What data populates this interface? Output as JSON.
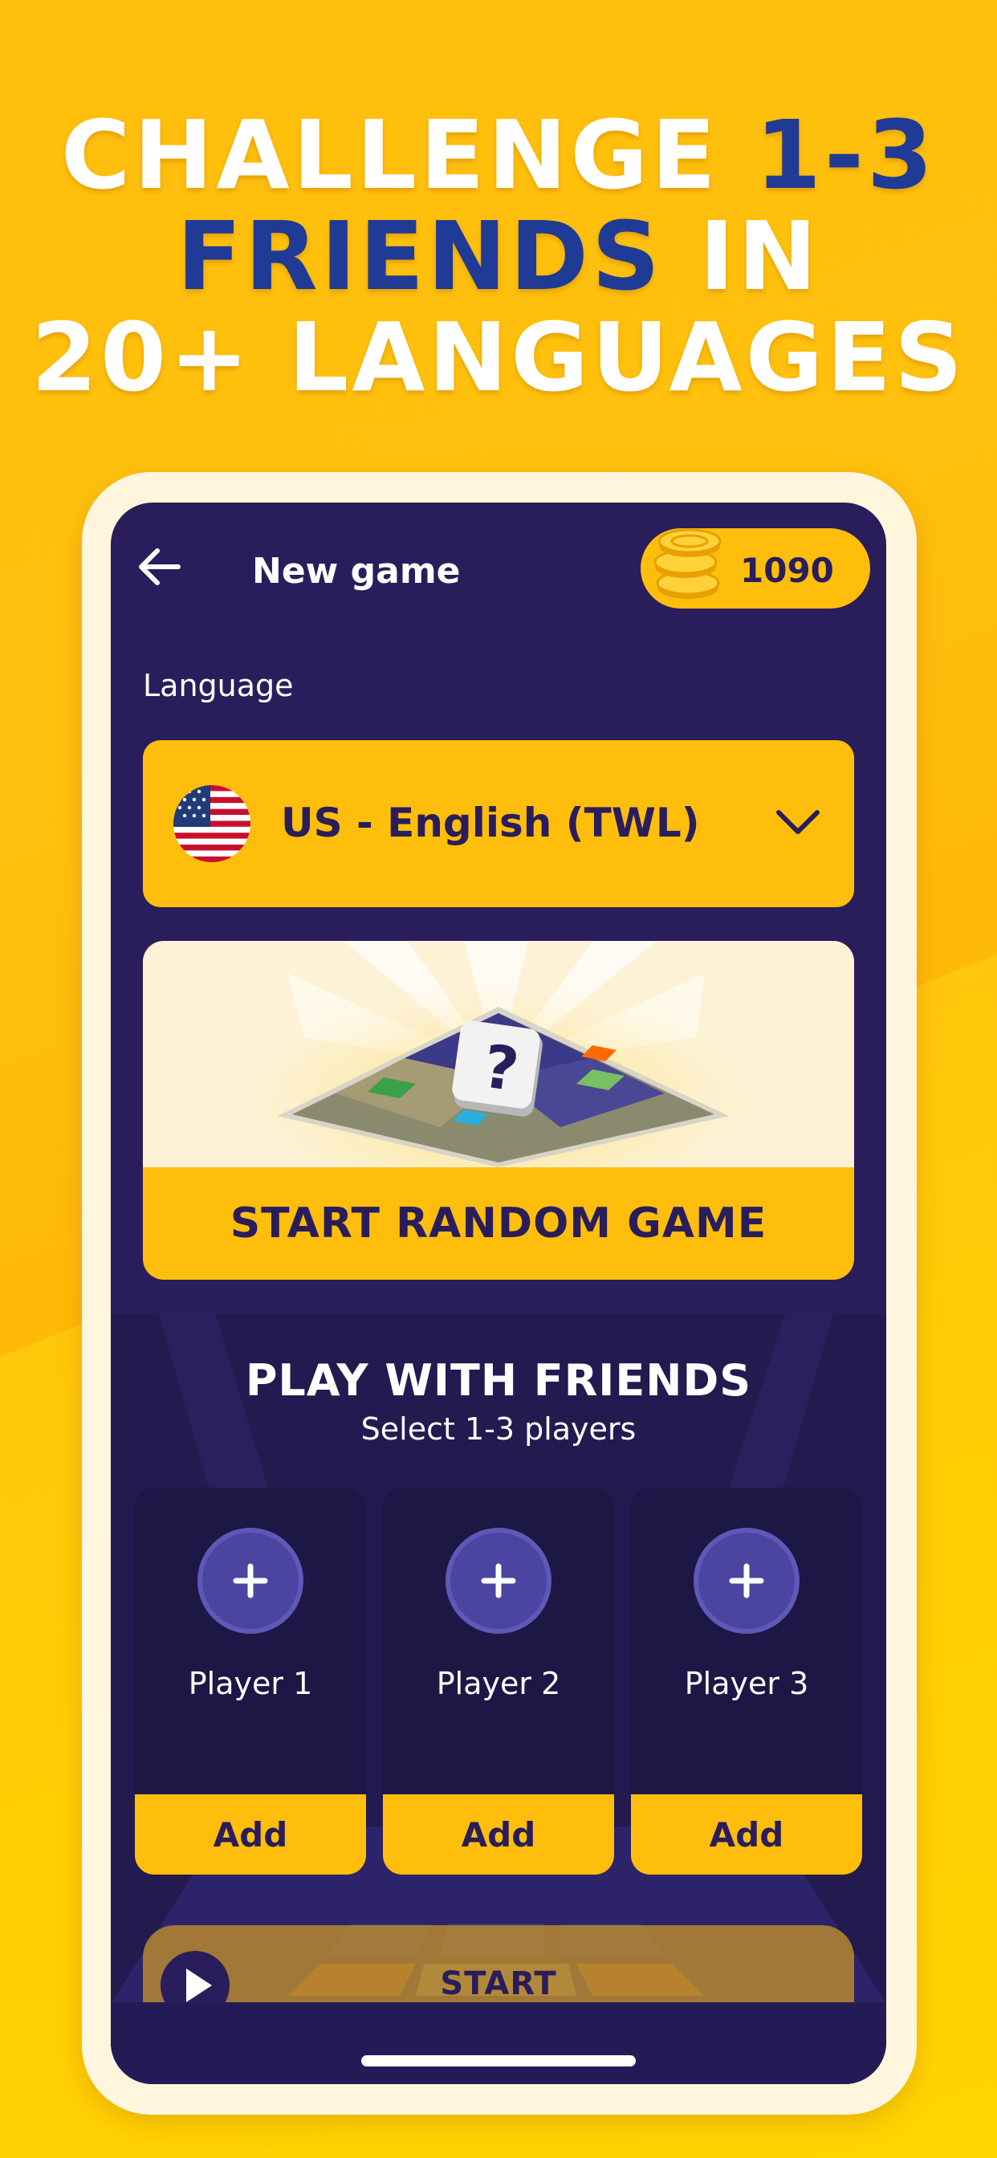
{
  "headline": {
    "line1_white": "CHALLENGE ",
    "line1_blue": "1-3",
    "line2_blue": "FRIENDS",
    "line2_white": " IN",
    "line3_white": "20+ LANGUAGES"
  },
  "header": {
    "title": "New game",
    "coins": "1090"
  },
  "language": {
    "label": "Language",
    "selected": "US - English (TWL)"
  },
  "random_game": {
    "tile_letter": "?",
    "label": "START RANDOM GAME"
  },
  "friends": {
    "title": "PLAY WITH FRIENDS",
    "subtitle": "Select 1-3 players",
    "players": [
      {
        "name": "Player 1",
        "button": "Add",
        "icon": "+"
      },
      {
        "name": "Player 2",
        "button": "Add",
        "icon": "+"
      },
      {
        "name": "Player 3",
        "button": "Add",
        "icon": "+"
      }
    ]
  },
  "start": {
    "label": "START"
  },
  "colors": {
    "accent": "#ffbe0b",
    "navy": "#2a1d5c",
    "blue_text": "#1f3b95",
    "player_card": "#1c1745",
    "plus_circle": "#4b44a0"
  },
  "icons": {
    "back": "arrow-left-icon",
    "coin": "coin-stack-icon",
    "flag": "us-flag-icon",
    "dropdown": "chevron-down-icon",
    "play": "play-icon"
  }
}
